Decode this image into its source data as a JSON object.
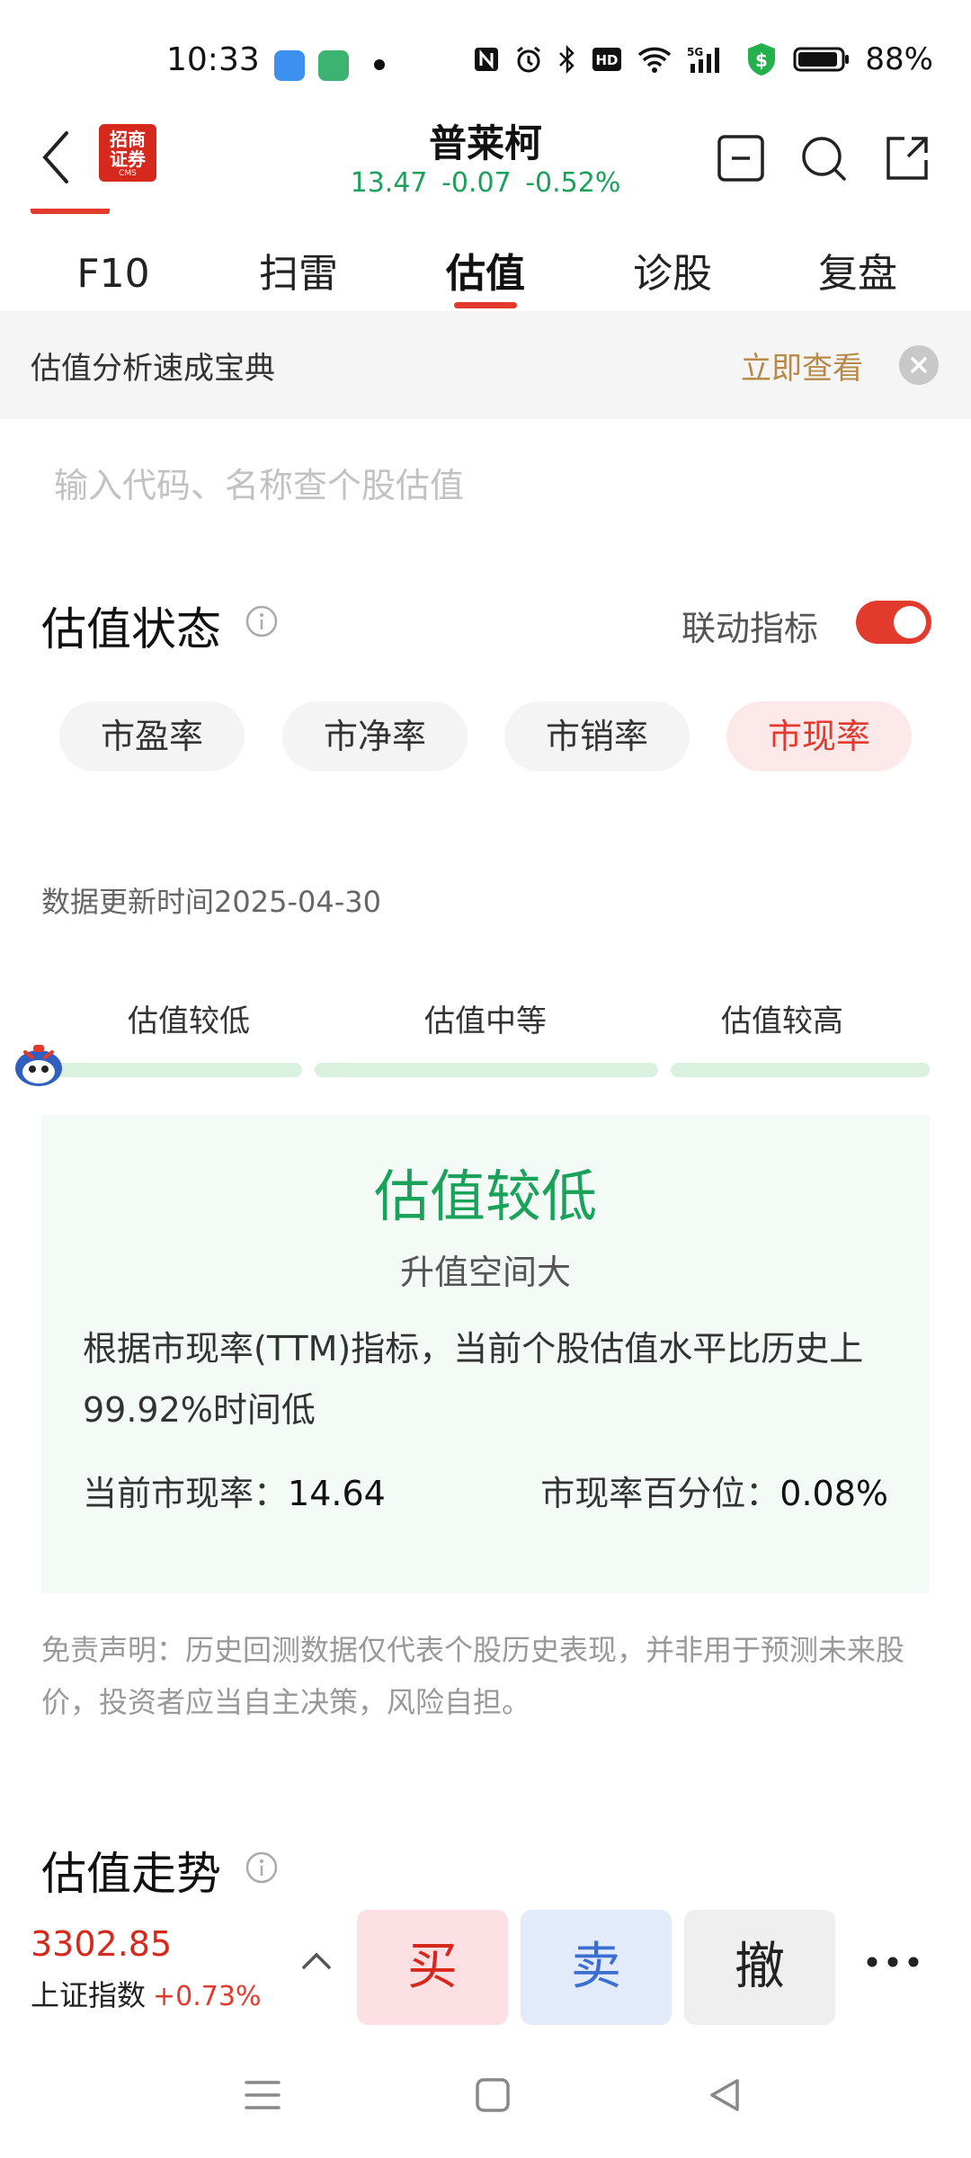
{
  "status_bar": {
    "time": "10:33",
    "network": "5G",
    "battery": "88%"
  },
  "header": {
    "broker_logo_text": "招商证券",
    "broker_logo_small": "CMS",
    "stock_name": "普莱柯",
    "price": "13.47",
    "change": "-0.07",
    "change_pct": "-0.52%"
  },
  "tabs": [
    {
      "label": "F10"
    },
    {
      "label": "扫雷"
    },
    {
      "label": "估值",
      "active": true
    },
    {
      "label": "诊股"
    },
    {
      "label": "复盘"
    }
  ],
  "banner": {
    "title": "估值分析速成宝典",
    "link": "立即查看"
  },
  "search": {
    "placeholder": "输入代码、名称查个股估值"
  },
  "valuation_status": {
    "title": "估值状态",
    "linkage_label": "联动指标",
    "linkage_on": true,
    "metrics": [
      {
        "label": "市盈率"
      },
      {
        "label": "市净率"
      },
      {
        "label": "市销率"
      },
      {
        "label": "市现率",
        "active": true
      }
    ],
    "update_time": "数据更新时间2025-04-30",
    "scale_labels": [
      "估值较低",
      "估值中等",
      "估值较高"
    ],
    "result": {
      "level": "估值较低",
      "subtitle": "升值空间大",
      "description": "根据市现率(TTM)指标，当前个股估值水平比历史上99.92%时间低",
      "current_label": "当前市现率：",
      "current_value": "14.64",
      "percentile_label": "市现率百分位：",
      "percentile_value": "0.08%"
    },
    "disclaimer": "免责声明：历史回测数据仅代表个股历史表现，并非用于预测未来股价，投资者应当自主决策，风险自担。"
  },
  "valuation_trend": {
    "title": "估值走势"
  },
  "trade_bar": {
    "index_value": "3302.85",
    "index_name": "上证指数",
    "index_change": "+0.73%",
    "buy": "买",
    "sell": "卖",
    "cancel": "撤"
  },
  "colors": {
    "accent_red": "#e33a2e",
    "green": "#1aa15a",
    "gold_link": "#b88a4a"
  }
}
